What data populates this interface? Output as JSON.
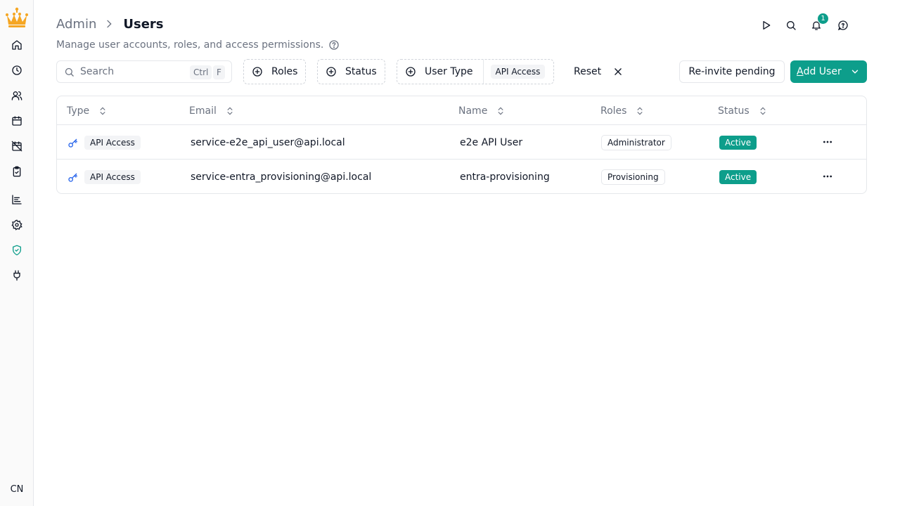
{
  "colors": {
    "accent": "#0d9e8b",
    "logo": "#f5a623",
    "key_icon": "#2563eb"
  },
  "header": {
    "breadcrumb_parent": "Admin",
    "breadcrumb_current": "Users",
    "subtitle": "Manage user accounts, roles, and access permissions."
  },
  "sidebar": {
    "items": [
      {
        "icon": "home-icon"
      },
      {
        "icon": "clock-icon"
      },
      {
        "icon": "users-icon"
      },
      {
        "icon": "calendar-icon"
      },
      {
        "icon": "calendar-off-icon"
      },
      {
        "icon": "clipboard-check-icon"
      },
      {
        "icon": "chart-icon"
      },
      {
        "icon": "gear-icon"
      },
      {
        "icon": "shield-check-icon"
      },
      {
        "icon": "plug-icon"
      }
    ],
    "avatar": "CN"
  },
  "top_actions": {
    "notification_count": "1"
  },
  "toolbar": {
    "search_placeholder": "Search",
    "shortcut_ctrl": "Ctrl",
    "shortcut_key": "F",
    "filter_roles": "Roles",
    "filter_status": "Status",
    "filter_user_type": "User Type",
    "filter_user_type_value": "API Access",
    "reset": "Reset",
    "reinvite": "Re-invite pending",
    "add_user_first": "A",
    "add_user_rest": "dd User"
  },
  "table": {
    "columns": [
      "Type",
      "Email",
      "Name",
      "Roles",
      "Status"
    ],
    "rows": [
      {
        "type": "API Access",
        "email": "service-e2e_api_user@api.local",
        "name": "e2e API User",
        "role": "Administrator",
        "status": "Active"
      },
      {
        "type": "API Access",
        "email": "service-entra_provisioning@api.local",
        "name": "entra-provisioning",
        "role": "Provisioning",
        "status": "Active"
      }
    ]
  }
}
